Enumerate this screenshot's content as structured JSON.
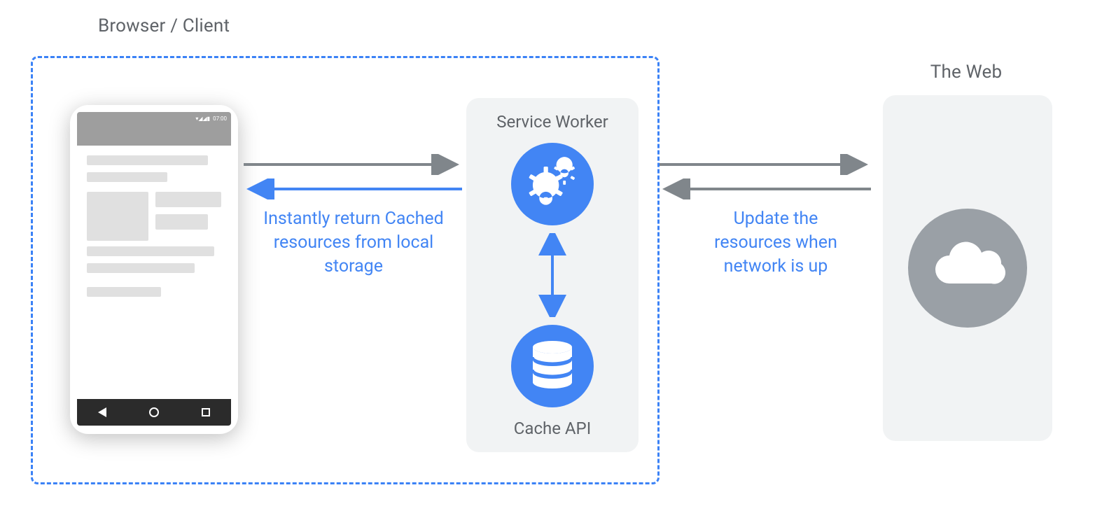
{
  "titles": {
    "browser_client": "Browser / Client",
    "the_web": "The Web"
  },
  "phone": {
    "status_time": "07:00"
  },
  "service_worker_panel": {
    "top_label": "Service Worker",
    "bottom_label": "Cache API"
  },
  "annotations": {
    "cached_resources": "Instantly return Cached resources from local storage",
    "update_resources": "Update the resources when network is up"
  },
  "arrows": {
    "phone_to_sw": {
      "direction": "right",
      "color": "#80868b"
    },
    "sw_to_phone": {
      "direction": "left",
      "color": "#4285f4"
    },
    "sw_to_cache": {
      "direction": "both",
      "color": "#4285f4"
    },
    "sw_to_web": {
      "direction": "right",
      "color": "#80868b"
    },
    "web_to_sw": {
      "direction": "left",
      "color": "#80868b"
    }
  },
  "colors": {
    "accent_blue": "#4285f4",
    "dashed_border": "#3b82f6",
    "panel_bg": "#f1f3f4",
    "grey_arrow": "#80868b",
    "cloud_bg": "#9aa0a6",
    "text_grey": "#5f6368"
  },
  "icons": {
    "gears": "gear-icon",
    "database": "database-icon",
    "cloud": "cloud-icon"
  }
}
